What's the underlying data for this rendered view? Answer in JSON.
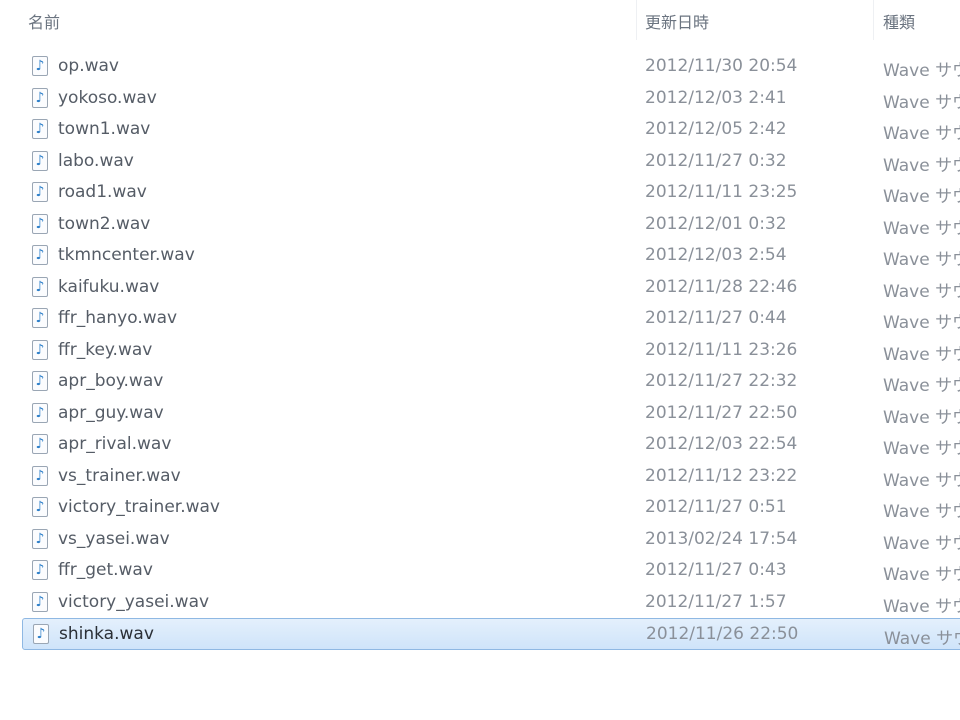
{
  "columns": {
    "name": "名前",
    "modified": "更新日時",
    "type": "種類"
  },
  "files": [
    {
      "name": "op.wav",
      "date": "2012/11/30 20:54",
      "type": "Wave サウ"
    },
    {
      "name": "yokoso.wav",
      "date": "2012/12/03 2:41",
      "type": "Wave サウ"
    },
    {
      "name": "town1.wav",
      "date": "2012/12/05 2:42",
      "type": "Wave サウ"
    },
    {
      "name": "labo.wav",
      "date": "2012/11/27 0:32",
      "type": "Wave サウ"
    },
    {
      "name": "road1.wav",
      "date": "2012/11/11 23:25",
      "type": "Wave サウ"
    },
    {
      "name": "town2.wav",
      "date": "2012/12/01 0:32",
      "type": "Wave サウ"
    },
    {
      "name": "tkmncenter.wav",
      "date": "2012/12/03 2:54",
      "type": "Wave サウ"
    },
    {
      "name": "kaifuku.wav",
      "date": "2012/11/28 22:46",
      "type": "Wave サウ"
    },
    {
      "name": "ffr_hanyo.wav",
      "date": "2012/11/27 0:44",
      "type": "Wave サウ"
    },
    {
      "name": "ffr_key.wav",
      "date": "2012/11/11 23:26",
      "type": "Wave サウ"
    },
    {
      "name": "apr_boy.wav",
      "date": "2012/11/27 22:32",
      "type": "Wave サウ"
    },
    {
      "name": "apr_guy.wav",
      "date": "2012/11/27 22:50",
      "type": "Wave サウ"
    },
    {
      "name": "apr_rival.wav",
      "date": "2012/12/03 22:54",
      "type": "Wave サウ"
    },
    {
      "name": "vs_trainer.wav",
      "date": "2012/11/12 23:22",
      "type": "Wave サウ"
    },
    {
      "name": "victory_trainer.wav",
      "date": "2012/11/27 0:51",
      "type": "Wave サウ"
    },
    {
      "name": "vs_yasei.wav",
      "date": "2013/02/24 17:54",
      "type": "Wave サウ"
    },
    {
      "name": "ffr_get.wav",
      "date": "2012/11/27 0:43",
      "type": "Wave サウ"
    },
    {
      "name": "victory_yasei.wav",
      "date": "2012/11/27 1:57",
      "type": "Wave サウ"
    },
    {
      "name": "shinka.wav",
      "date": "2012/11/26 22:50",
      "type": "Wave サウ",
      "selected": true
    }
  ],
  "icon": "audio-file-icon",
  "selection_color": "#cfe4fa"
}
